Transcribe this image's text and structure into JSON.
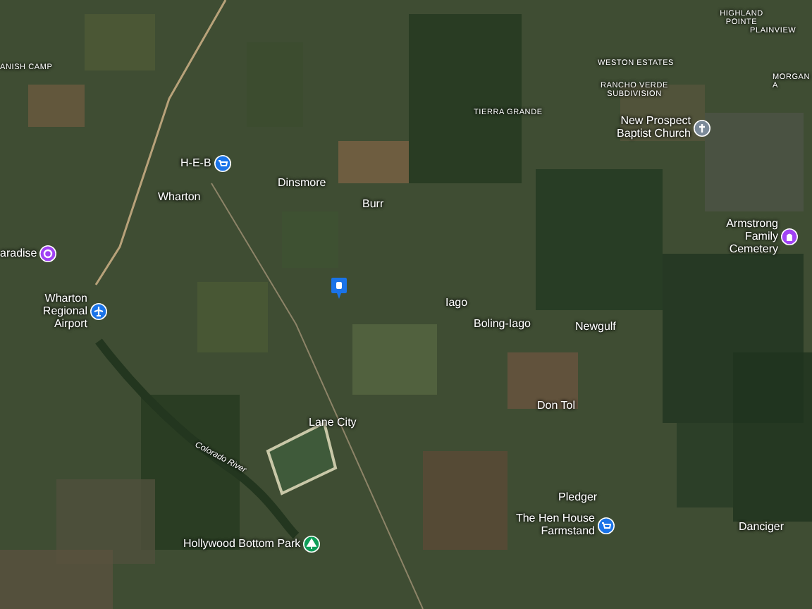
{
  "map": {
    "places": [
      {
        "label": "ANISH CAMP",
        "kind": "area"
      },
      {
        "label": "HIGHLAND POINTE",
        "kind": "area"
      },
      {
        "label": "PLAINVIEW",
        "kind": "area"
      },
      {
        "label": "WESTON ESTATES",
        "kind": "area"
      },
      {
        "label": "RANCHO VERDE SUBDIVISION",
        "kind": "area"
      },
      {
        "label": "MORGAN A",
        "kind": "area"
      },
      {
        "label": "TIERRA GRANDE",
        "kind": "area"
      },
      {
        "label": "New Prospect Baptist Church",
        "kind": "poi",
        "pin": {
          "color": "#7b8a99"
        }
      },
      {
        "label": "H-E-B",
        "kind": "poi",
        "pin": {
          "color": "#1a73e8"
        }
      },
      {
        "label": "Dinsmore",
        "kind": "town"
      },
      {
        "label": "Wharton",
        "kind": "town"
      },
      {
        "label": "Burr",
        "kind": "town"
      },
      {
        "label": "aradise",
        "kind": "poi",
        "pin": {
          "color": "#a142f4"
        }
      },
      {
        "label": "Armstrong Family Cemetery",
        "kind": "poi",
        "pin": {
          "color": "#a142f4"
        }
      },
      {
        "label": "Wharton Regional Airport",
        "kind": "poi",
        "pin": {
          "color": "#1a73e8"
        }
      },
      {
        "kind": "marker",
        "pin": {
          "color": "#1a73e8"
        }
      },
      {
        "label": "Iago",
        "kind": "town"
      },
      {
        "label": "Boling-Iago",
        "kind": "town"
      },
      {
        "label": "Newgulf",
        "kind": "town"
      },
      {
        "label": "Don Tol",
        "kind": "town"
      },
      {
        "label": "Lane City",
        "kind": "town"
      },
      {
        "label": "Colorado River",
        "kind": "river"
      },
      {
        "label": "Hollywood Bottom Park",
        "kind": "poi",
        "pin": {
          "color": "#0f9d58"
        }
      },
      {
        "label": "Pledger",
        "kind": "town"
      },
      {
        "label": "The Hen House Farmstand",
        "kind": "poi",
        "pin": {
          "color": "#1a73e8"
        }
      },
      {
        "label": "Danciger",
        "kind": "town"
      }
    ]
  }
}
